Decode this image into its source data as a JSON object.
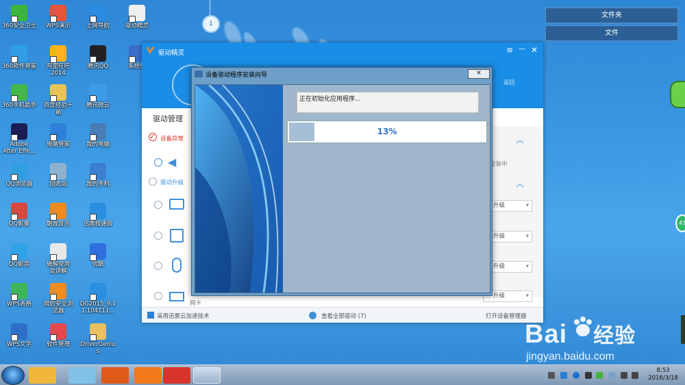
{
  "desktop_icons": [
    {
      "label": "360安全卫士",
      "color": "#3cb53c"
    },
    {
      "label": "WPS演示",
      "color": "#e6553a"
    },
    {
      "label": "上网导航",
      "color": "#2b8be0"
    },
    {
      "label": "驱动精灵",
      "color": "#f0f0f0"
    },
    {
      "label": "360软件管家",
      "color": "#2f9ee6"
    },
    {
      "label": "阿里旺旺\n2014",
      "color": "#ffb21d"
    },
    {
      "label": "腾讯QQ",
      "color": "#222222"
    },
    {
      "label": "系统修",
      "color": "#3a6ec8"
    },
    {
      "label": "360手机助手",
      "color": "#45b648"
    },
    {
      "label": "百度经验十\n谕",
      "color": "#e7c453"
    },
    {
      "label": "腾讯微云",
      "color": "#3c9ce8"
    },
    {
      "label": "Adobe\nAfter Effe...",
      "color": "#1b1f56"
    },
    {
      "label": "电脑管家",
      "color": "#2d7fd8"
    },
    {
      "label": "我的电脑",
      "color": "#4a7cb6"
    },
    {
      "label": "QQ浏览器",
      "color": "#2f9fe0"
    },
    {
      "label": "回收站",
      "color": "#8fb1d0"
    },
    {
      "label": "我的手机",
      "color": "#3c7fd0"
    },
    {
      "label": "QQ影像",
      "color": "#d9483f"
    },
    {
      "label": "酷我音乐",
      "color": "#f08a1c"
    },
    {
      "label": "迅雷极速版",
      "color": "#2a8fe0"
    },
    {
      "label": "QQ影音",
      "color": "#2fa2e6"
    },
    {
      "label": "破解使用\n及讲解",
      "color": "#e8e8e8"
    },
    {
      "label": "优酷",
      "color": "#2f6fe0"
    },
    {
      "label": "WPS表格",
      "color": "#3fb55a"
    },
    {
      "label": "猎豹安全浏\n览器",
      "color": "#f28b20"
    },
    {
      "label": "DG2015_9.1\n1.104111...",
      "color": "#2a8fe0"
    },
    {
      "label": "WPS文字",
      "color": "#2d6fc8"
    },
    {
      "label": "软件管理",
      "color": "#e5484d"
    },
    {
      "label": "DriverGeniu\ns",
      "color": "#e8c060"
    }
  ],
  "top_panel": {
    "folder_button": "文件夹",
    "file_button": "文件"
  },
  "main_window": {
    "title": "驱动精灵",
    "menu_icon": "≡",
    "minimize_icon": "—",
    "close_icon": "✕",
    "back_link": "返回",
    "section_title": "驱动管理",
    "item_device_error": "设备异常",
    "item_driver_upgrade": "驱动升级",
    "right_installing": "安装中",
    "upgrade_options": [
      "升级",
      "升级",
      "升级",
      "升级"
    ],
    "row_label": "网卡",
    "bottom_left": "采用迅雷云加速技术",
    "bottom_center": "查看全部驱动 (7)",
    "bottom_right": "打开设备管理器"
  },
  "installer": {
    "title": "设备驱动程序安装向导",
    "close_label": "✕",
    "status_text": "正在初始化应用程序...",
    "progress_label": "13%",
    "progress_value": 0.13
  },
  "watermark": {
    "brand_left": "Bai",
    "brand_right": "经验",
    "url": "jingyan.baidu.com"
  },
  "side_badge": "43",
  "taskbar": {
    "time": "8:53",
    "date": "2016/3/18",
    "apps": [
      {
        "name": "explorer",
        "color": "#7fc1e8"
      },
      {
        "name": "media",
        "color": "#e05a1a"
      },
      {
        "name": "taobao",
        "color": "#f27a1a"
      },
      {
        "name": "driver-genius",
        "color": "#d5352b"
      },
      {
        "name": "device-wizard",
        "color": "#3b6ea8"
      }
    ]
  }
}
